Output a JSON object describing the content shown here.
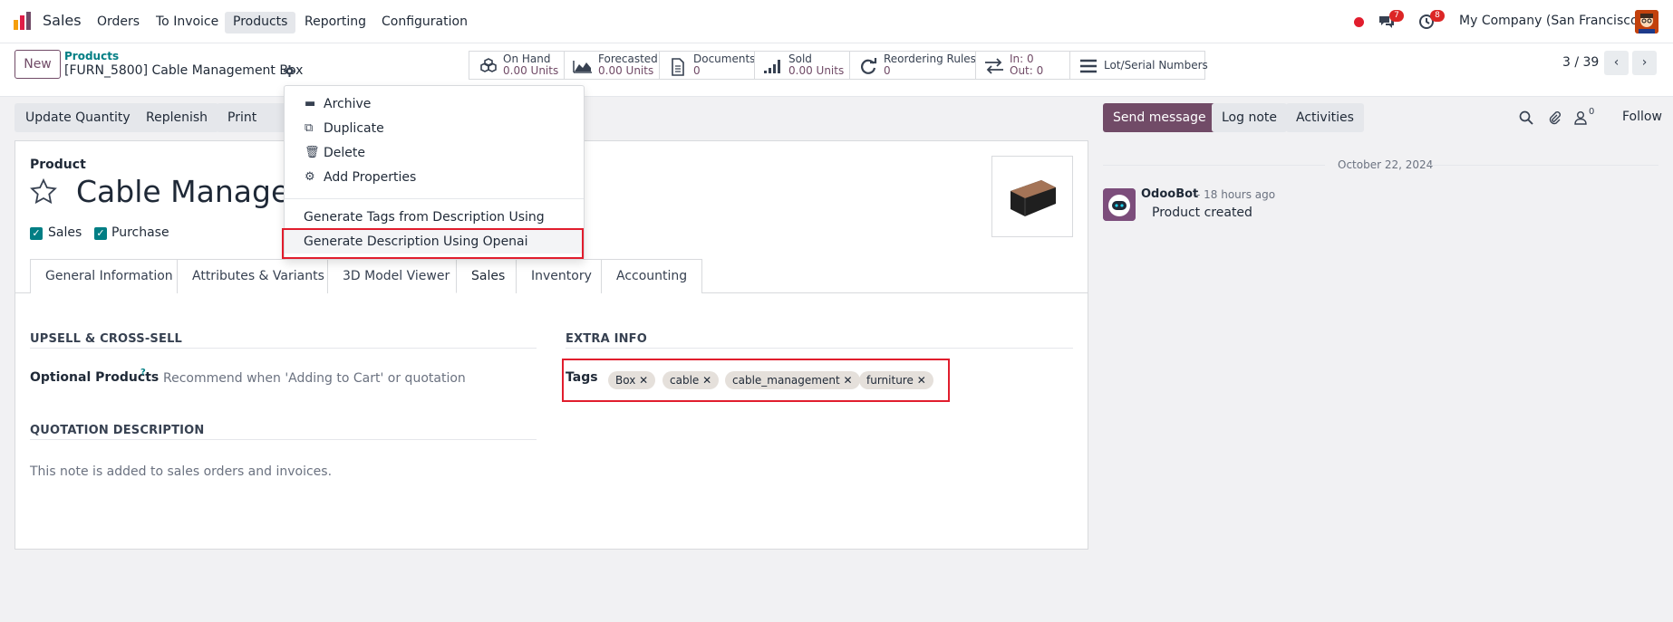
{
  "topnav": {
    "app_name": "Sales",
    "menu": [
      "Orders",
      "To Invoice",
      "Products",
      "Reporting",
      "Configuration"
    ],
    "active_menu": "Products",
    "messages_badge": "7",
    "activities_badge": "8",
    "company": "My Company (San Francisco)"
  },
  "breadcrumb": {
    "parent": "Products",
    "current": "[FURN_5800] Cable Management Box"
  },
  "buttons": {
    "new": "New"
  },
  "smart_buttons": [
    {
      "label": "On Hand",
      "value": "0.00 Units",
      "icon": "cubes-icon"
    },
    {
      "label": "Forecasted",
      "value": "0.00 Units",
      "icon": "area-chart-icon"
    },
    {
      "label": "Documents",
      "value": "0",
      "icon": "file-icon"
    },
    {
      "label": "Sold",
      "value": "0.00 Units",
      "icon": "signal-icon"
    },
    {
      "label": "Reordering Rules",
      "value": "0",
      "icon": "refresh-icon"
    },
    {
      "label": "In: 0",
      "value": "Out: 0",
      "icon": "exchange-icon"
    },
    {
      "label": "Lot/Serial Numbers",
      "value": "",
      "icon": "bars-icon"
    }
  ],
  "pager": {
    "text": "3 / 39"
  },
  "actions": [
    "Update Quantity",
    "Replenish",
    "Print Labe"
  ],
  "dropdown": {
    "items": [
      {
        "label": "Archive",
        "icon": "archive-icon"
      },
      {
        "label": "Duplicate",
        "icon": "copy-icon"
      },
      {
        "label": "Delete",
        "icon": "trash-icon"
      },
      {
        "label": "Add Properties",
        "icon": "cogs-icon"
      }
    ],
    "ai_items": [
      "Generate Tags from Description Using Openai",
      "Generate Description Using Openai"
    ]
  },
  "product": {
    "label": "Product",
    "name": "Cable Managen",
    "sales_checkbox": "Sales",
    "purchase_checkbox": "Purchase"
  },
  "tabs": [
    "General Information",
    "Attributes & Variants",
    "3D Model Viewer",
    "Sales",
    "Inventory",
    "Accounting"
  ],
  "active_tab": "Sales",
  "sales_tab": {
    "upsell_title": "UPSELL & CROSS-SELL",
    "optional_products_label": "Optional Products",
    "optional_products_help": "?",
    "optional_products_placeholder": "Recommend when 'Adding to Cart' or quotation",
    "extra_info_title": "EXTRA INFO",
    "tags_label": "Tags",
    "tags": [
      "Box",
      "cable",
      "cable_management",
      "furniture"
    ],
    "quotation_title": "QUOTATION DESCRIPTION",
    "quotation_placeholder": "This note is added to sales orders and invoices."
  },
  "chatter": {
    "send_message": "Send message",
    "log_note": "Log note",
    "activities": "Activities",
    "followers_count": "0",
    "follow": "Follow",
    "date": "October 22, 2024",
    "author": "OdooBot",
    "time": "- 18 hours ago",
    "message": "Product created"
  },
  "colors": {
    "brand": "#714b67",
    "accent": "#017e84",
    "highlight": "#e11d2d"
  }
}
